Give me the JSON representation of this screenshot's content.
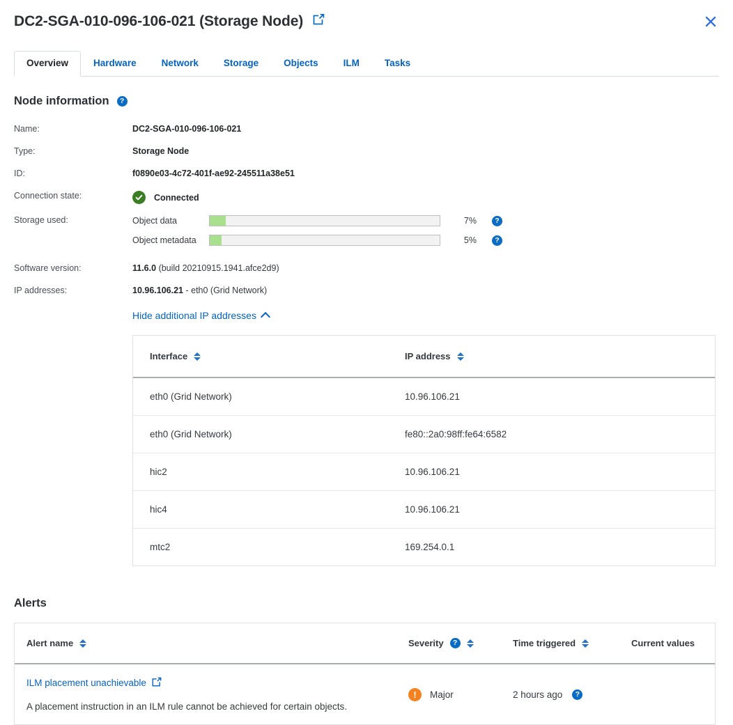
{
  "header": {
    "title": "DC2-SGA-010-096-106-021 (Storage Node)",
    "external_link_icon": "external-link-icon",
    "close_icon": "close-icon"
  },
  "tabs": [
    {
      "label": "Overview",
      "active": true
    },
    {
      "label": "Hardware",
      "active": false
    },
    {
      "label": "Network",
      "active": false
    },
    {
      "label": "Storage",
      "active": false
    },
    {
      "label": "Objects",
      "active": false
    },
    {
      "label": "ILM",
      "active": false
    },
    {
      "label": "Tasks",
      "active": false
    }
  ],
  "node_information": {
    "heading": "Node information",
    "help_glyph": "?",
    "rows": {
      "name_label": "Name:",
      "name_value": "DC2-SGA-010-096-106-021",
      "type_label": "Type:",
      "type_value": "Storage Node",
      "id_label": "ID:",
      "id_value": "f0890e03-4c72-401f-ae92-245511a38e51",
      "connection_label": "Connection state:",
      "connection_value": "Connected",
      "storage_label": "Storage used:",
      "software_label": "Software version:",
      "software_value": "11.6.0",
      "software_build": "(build 20210915.1941.afce2d9)",
      "ip_label": "IP addresses:",
      "ip_value": "10.96.106.21",
      "ip_iface": "- eth0 (Grid Network)"
    },
    "storage_used": [
      {
        "name": "Object data",
        "percent": 7,
        "percent_label": "7%"
      },
      {
        "name": "Object metadata",
        "percent": 5,
        "percent_label": "5%"
      }
    ]
  },
  "additional_ip": {
    "toggle_label": "Hide additional IP addresses",
    "columns": [
      "Interface",
      "IP address"
    ],
    "rows": [
      {
        "interface": "eth0 (Grid Network)",
        "ip": "10.96.106.21"
      },
      {
        "interface": "eth0 (Grid Network)",
        "ip": "fe80::2a0:98ff:fe64:6582"
      },
      {
        "interface": "hic2",
        "ip": "10.96.106.21"
      },
      {
        "interface": "hic4",
        "ip": "10.96.106.21"
      },
      {
        "interface": "mtc2",
        "ip": "169.254.0.1"
      }
    ]
  },
  "alerts": {
    "heading": "Alerts",
    "columns": {
      "name": "Alert name",
      "severity": "Severity",
      "time": "Time triggered",
      "current": "Current values"
    },
    "rows": [
      {
        "name": "ILM placement unachievable",
        "description": "A placement instruction in an ILM rule cannot be achieved for certain objects.",
        "severity": "Major",
        "severity_glyph": "!",
        "time": "2 hours ago",
        "current_values": ""
      }
    ]
  },
  "colors": {
    "link": "#0563c1",
    "bar_fill": "#a9e08e",
    "ok_green": "#3b7d23",
    "major_orange": "#f58220",
    "help_blue": "#0a6cc4"
  }
}
